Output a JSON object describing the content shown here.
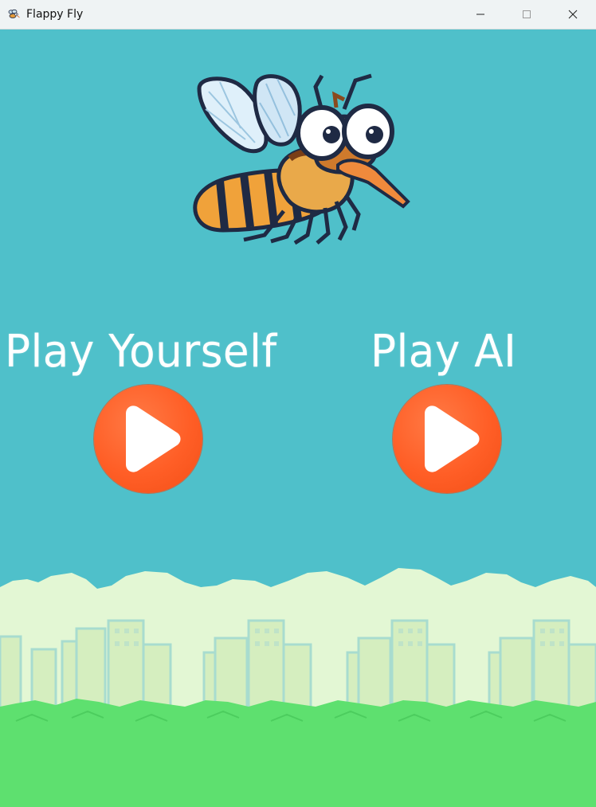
{
  "window": {
    "title": "Flappy Fly",
    "controls": [
      "minimize",
      "maximize",
      "close"
    ]
  },
  "menu": {
    "play_yourself_label": "Play Yourself",
    "play_ai_label": "Play AI"
  },
  "colors": {
    "sky": "#4fc0ca",
    "cloud": "#e3f7d4",
    "buildings": "#d5eebf",
    "grass": "#5ee06f",
    "play_button": "#ff5e26",
    "label_text": "#ffffff"
  },
  "icons": {
    "app": "fly-icon",
    "play": "play-triangle-icon",
    "character": "mosquito-sprite"
  }
}
